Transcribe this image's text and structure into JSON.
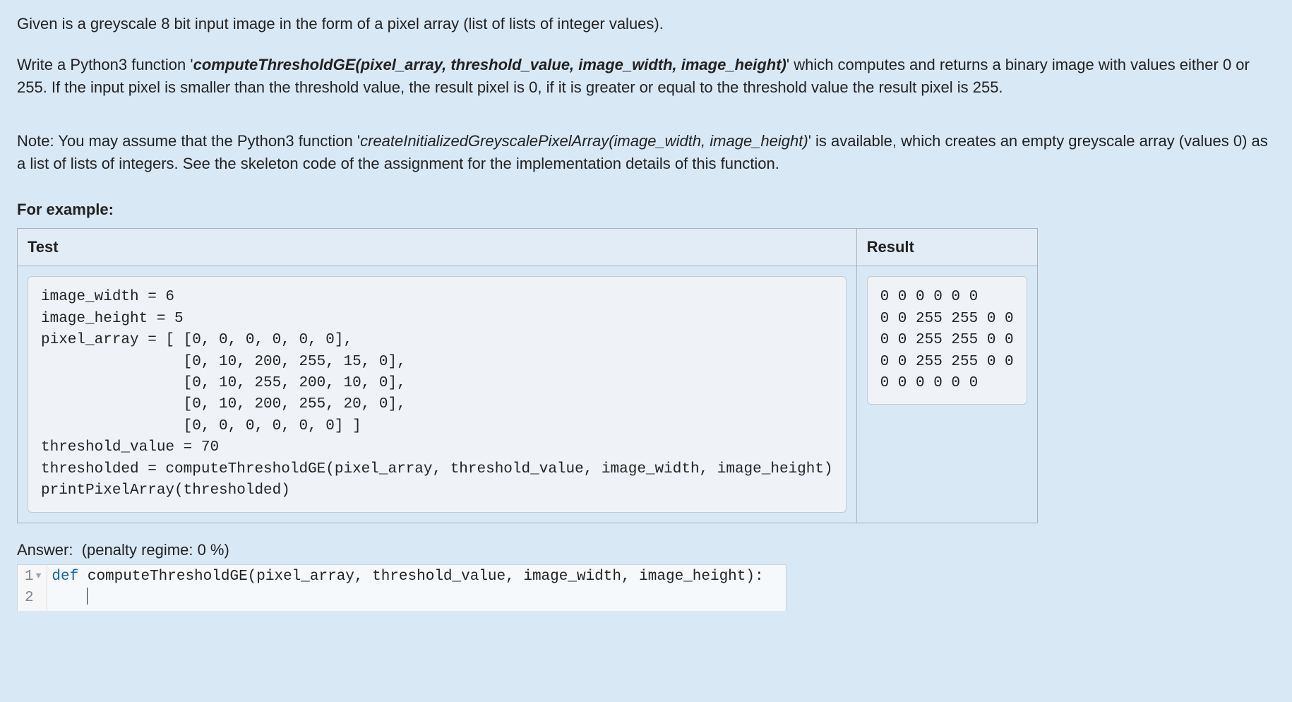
{
  "intro": {
    "p1_a": "Given is a greyscale 8 bit input image in the form of a pixel array (list of lists of integer values).",
    "p2_a": "Write a Python3 function '",
    "p2_b": "computeThresholdGE(pixel_array, threshold_value, image_width, image_height)",
    "p2_c": "' which computes and returns a binary image with values either 0 or 255. If the input pixel is smaller than the threshold value, the result pixel is 0, if it is greater or equal to the threshold value the result pixel is 255.",
    "p3_a": "Note: You may assume that the Python3 function '",
    "p3_b": "createInitializedGreyscalePixelArray(image_width, image_height)",
    "p3_c": "' is available, which creates an empty greyscale array (values 0) as a list of lists of integers. See the skeleton code of the assignment for the implementation details of this function."
  },
  "forExample": "For example:",
  "table": {
    "headers": {
      "test": "Test",
      "result": "Result"
    },
    "testCode": "image_width = 6\nimage_height = 5\npixel_array = [ [0, 0, 0, 0, 0, 0],\n                [0, 10, 200, 255, 15, 0],\n                [0, 10, 255, 200, 10, 0],\n                [0, 10, 200, 255, 20, 0],\n                [0, 0, 0, 0, 0, 0] ]\nthreshold_value = 70\nthresholded = computeThresholdGE(pixel_array, threshold_value, image_width, image_height)\nprintPixelArray(thresholded)",
    "resultText": "0 0 0 0 0 0\n0 0 255 255 0 0\n0 0 255 255 0 0\n0 0 255 255 0 0\n0 0 0 0 0 0"
  },
  "answer": {
    "label": "Answer:",
    "penalty": "(penalty regime: 0 %)"
  },
  "editor": {
    "line1_num": "1",
    "line2_num": "2",
    "kw": "def",
    "sig": " computeThresholdGE(pixel_array, threshold_value, image_width, image_height):"
  }
}
